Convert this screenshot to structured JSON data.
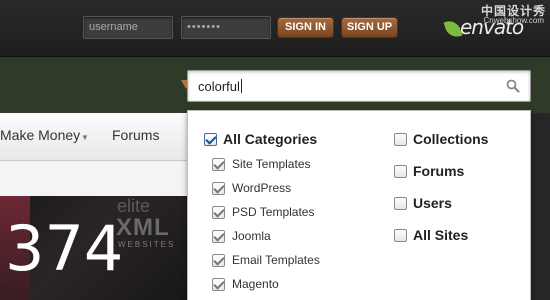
{
  "header": {
    "username_placeholder": "username",
    "password_mask": "•••••••",
    "sign_in_label": "SIGN IN",
    "sign_up_label": "SIGN UP",
    "logo_text": "envato",
    "watermark_top": "中国设计秀",
    "watermark_bottom": "Cnwebshow.com"
  },
  "nav": {
    "items": [
      {
        "label": "Make Money",
        "has_dropdown": true
      },
      {
        "label": "Forums",
        "has_dropdown": false
      }
    ]
  },
  "banner": {
    "brand_word": "elite",
    "brand_big": "XML",
    "brand_small": "WEBSITES",
    "count": "374"
  },
  "search": {
    "value": "colorful",
    "icon": "search-icon"
  },
  "filters": {
    "left_header": {
      "label": "All Categories",
      "checked": true
    },
    "left": [
      {
        "label": "Site Templates",
        "checked": true
      },
      {
        "label": "WordPress",
        "checked": true
      },
      {
        "label": "PSD Templates",
        "checked": true
      },
      {
        "label": "Joomla",
        "checked": true
      },
      {
        "label": "Email Templates",
        "checked": true
      },
      {
        "label": "Magento",
        "checked": true
      }
    ],
    "right": [
      {
        "label": "Collections",
        "checked": false
      },
      {
        "label": "Forums",
        "checked": false
      },
      {
        "label": "Users",
        "checked": false
      },
      {
        "label": "All Sites",
        "checked": false
      }
    ]
  },
  "colors": {
    "accent_brown": "#8a5229",
    "band_green": "#2f3a28",
    "logo_green": "#7fba3f"
  }
}
